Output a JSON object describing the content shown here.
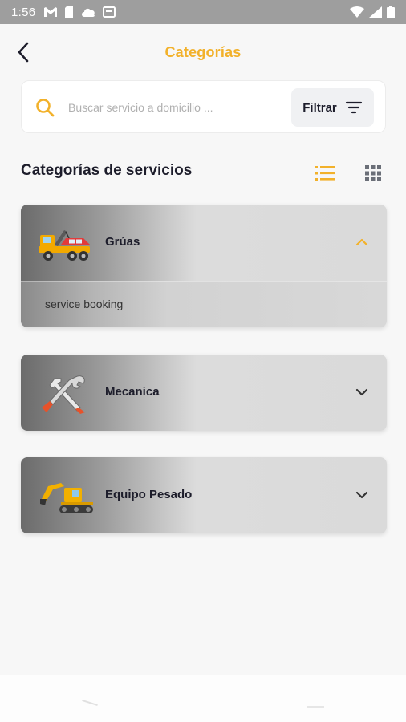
{
  "status_bar": {
    "time": "1:56",
    "left_icons": [
      "gmail-icon",
      "sim-card-icon",
      "cloud-icon",
      "storage-icon"
    ],
    "right_icons": [
      "wifi-icon",
      "signal-icon",
      "battery-icon"
    ]
  },
  "header": {
    "title": "Categorías",
    "back_icon": "chevron-left-icon",
    "title_color": "#f2b12a"
  },
  "search": {
    "placeholder": "Buscar servicio a domicilio ...",
    "value": "",
    "filter_label": "Filtrar",
    "icon": "search-icon",
    "filter_icon": "filter-icon",
    "accent_color": "#f2b12a"
  },
  "section": {
    "title": "Categorías de servicios",
    "view_modes": [
      "list-view-icon",
      "grid-view-icon"
    ],
    "active_view": "list"
  },
  "categories": [
    {
      "label": "Grúas",
      "icon": "tow-truck-icon",
      "expanded": true,
      "items": [
        "service booking"
      ]
    },
    {
      "label": "Mecanica",
      "icon": "wrench-hammer-icon",
      "expanded": false,
      "items": []
    },
    {
      "label": "Equipo Pesado",
      "icon": "excavator-icon",
      "expanded": false,
      "items": []
    }
  ]
}
